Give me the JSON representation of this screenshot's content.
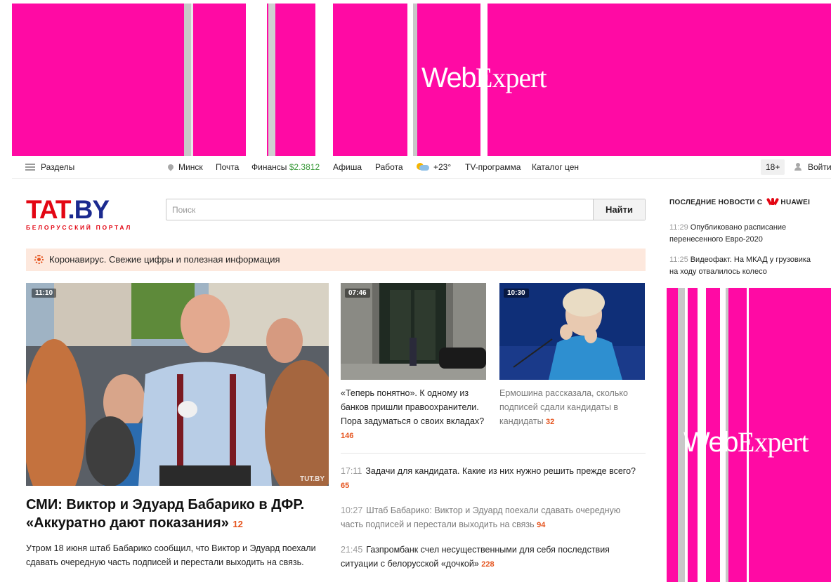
{
  "ad_top": {
    "logo_text_left": "Web",
    "logo_text_right": "Expert"
  },
  "ad_right": {
    "logo_text_left": "Web",
    "logo_text_right": "Expert"
  },
  "topbar": {
    "sections_label": "Разделы",
    "city": "Минск",
    "mail": "Почта",
    "finance_label": "Финансы",
    "finance_value": "$2.3812",
    "afisha": "Афиша",
    "jobs": "Работа",
    "weather": "+23°",
    "tv": "TV-программа",
    "prices": "Каталог цен",
    "age": "18+",
    "login": "Войти"
  },
  "logo": {
    "main_left": "TAT",
    "main_right": ".BY",
    "tagline": "БЕЛОРУССКИЙ ПОРТАЛ"
  },
  "search": {
    "placeholder": "Поиск",
    "button": "Найти"
  },
  "covid": {
    "text": "Коронавирус. Свежие цифры и полезная информация"
  },
  "main_story": {
    "time": "11:10",
    "watermark": "TUT.BY",
    "title": "СМИ: Виктор и Эдуард Бабарико в ДФР. «Аккуратно дают показания»",
    "comments": "12",
    "lead": "Утром 18 июня штаб Бабарико сообщил, что Виктор и Эдуард поехали сдавать очередную часть подписей и перестали выходить на связь."
  },
  "cards": [
    {
      "time": "07:46",
      "title": "«Теперь понятно». К одному из банков пришли правоохранители. Пора задуматься о своих вкладах?",
      "comments": "146"
    },
    {
      "time": "10:30",
      "title": "Ермошина рассказала, сколько подписей сдали кандидаты в кандидаты",
      "comments": "32"
    }
  ],
  "news": [
    {
      "time": "17:11",
      "title": "Задачи для кандидата. Какие из них нужно решить прежде всего?",
      "comments": "65"
    },
    {
      "time": "10:27",
      "title": "Штаб Бабарико: Виктор и Эдуард поехали сдавать очередную часть подписей и перестали выходить на связь",
      "comments": "94"
    },
    {
      "time": "21:45",
      "title": "Газпромбанк счел несущественными для себя последствия ситуации с белорусской «дочкой»",
      "comments": "228"
    }
  ],
  "right_column": {
    "heading": "ПОСЛЕДНИЕ НОВОСТИ С",
    "brand": "HUAWEI",
    "items": [
      {
        "time": "11:29",
        "title": "Опубликовано расписание перенесенного Евро-2020"
      },
      {
        "time": "11:25",
        "title": "Видеофакт. На МКАД у грузовика на ходу отвалилось колесо"
      }
    ]
  },
  "colors": {
    "ad_bg": "#ff0aa4",
    "accent_red": "#e30613",
    "logo_blue": "#1b2a8f",
    "counter": "#e5541e",
    "covid_bg": "#fde8dd",
    "finance_green": "#3a9a3a"
  }
}
